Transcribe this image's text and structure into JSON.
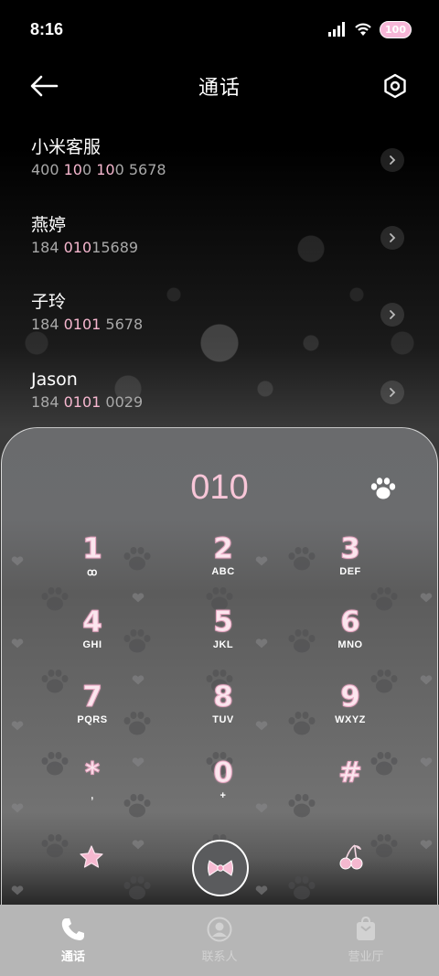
{
  "status_bar": {
    "time": "8:16",
    "battery_label": "100"
  },
  "header": {
    "title": "通话"
  },
  "contacts": [
    {
      "name": "小米客服",
      "number_parts": [
        "400 ",
        "10",
        "0 ",
        "10",
        "0 5678"
      ],
      "highlight": [
        false,
        true,
        false,
        true,
        false
      ]
    },
    {
      "name": "燕婷",
      "number_parts": [
        "184 ",
        "010",
        "15689"
      ],
      "highlight": [
        false,
        true,
        false
      ]
    },
    {
      "name": "子玲",
      "number_parts": [
        "184 ",
        "0101",
        " 5678"
      ],
      "highlight": [
        false,
        true,
        false
      ]
    },
    {
      "name": "Jason",
      "number_parts": [
        "184 ",
        "0101",
        " 0029"
      ],
      "highlight": [
        false,
        true,
        false
      ]
    }
  ],
  "dialer": {
    "dialed_number": "010",
    "keys": [
      {
        "digit": "1",
        "letters": "ꝏ"
      },
      {
        "digit": "2",
        "letters": "ABC"
      },
      {
        "digit": "3",
        "letters": "DEF"
      },
      {
        "digit": "4",
        "letters": "GHI"
      },
      {
        "digit": "5",
        "letters": "JKL"
      },
      {
        "digit": "6",
        "letters": "MNO"
      },
      {
        "digit": "7",
        "letters": "PQRS"
      },
      {
        "digit": "8",
        "letters": "TUV"
      },
      {
        "digit": "9",
        "letters": "WXYZ"
      },
      {
        "digit": "*",
        "letters": ","
      },
      {
        "digit": "0",
        "letters": "+"
      },
      {
        "digit": "#",
        "letters": ""
      }
    ]
  },
  "bottom_nav": {
    "items": [
      {
        "label": "通话",
        "icon": "phone-icon",
        "active": true
      },
      {
        "label": "联系人",
        "icon": "person-icon",
        "active": false
      },
      {
        "label": "营业厅",
        "icon": "shop-bag-icon",
        "active": false
      }
    ]
  },
  "colors": {
    "accent_pink": "#f8c6d8",
    "nav_bar": "#b6b6b6",
    "panel": "#6a6b6d"
  }
}
